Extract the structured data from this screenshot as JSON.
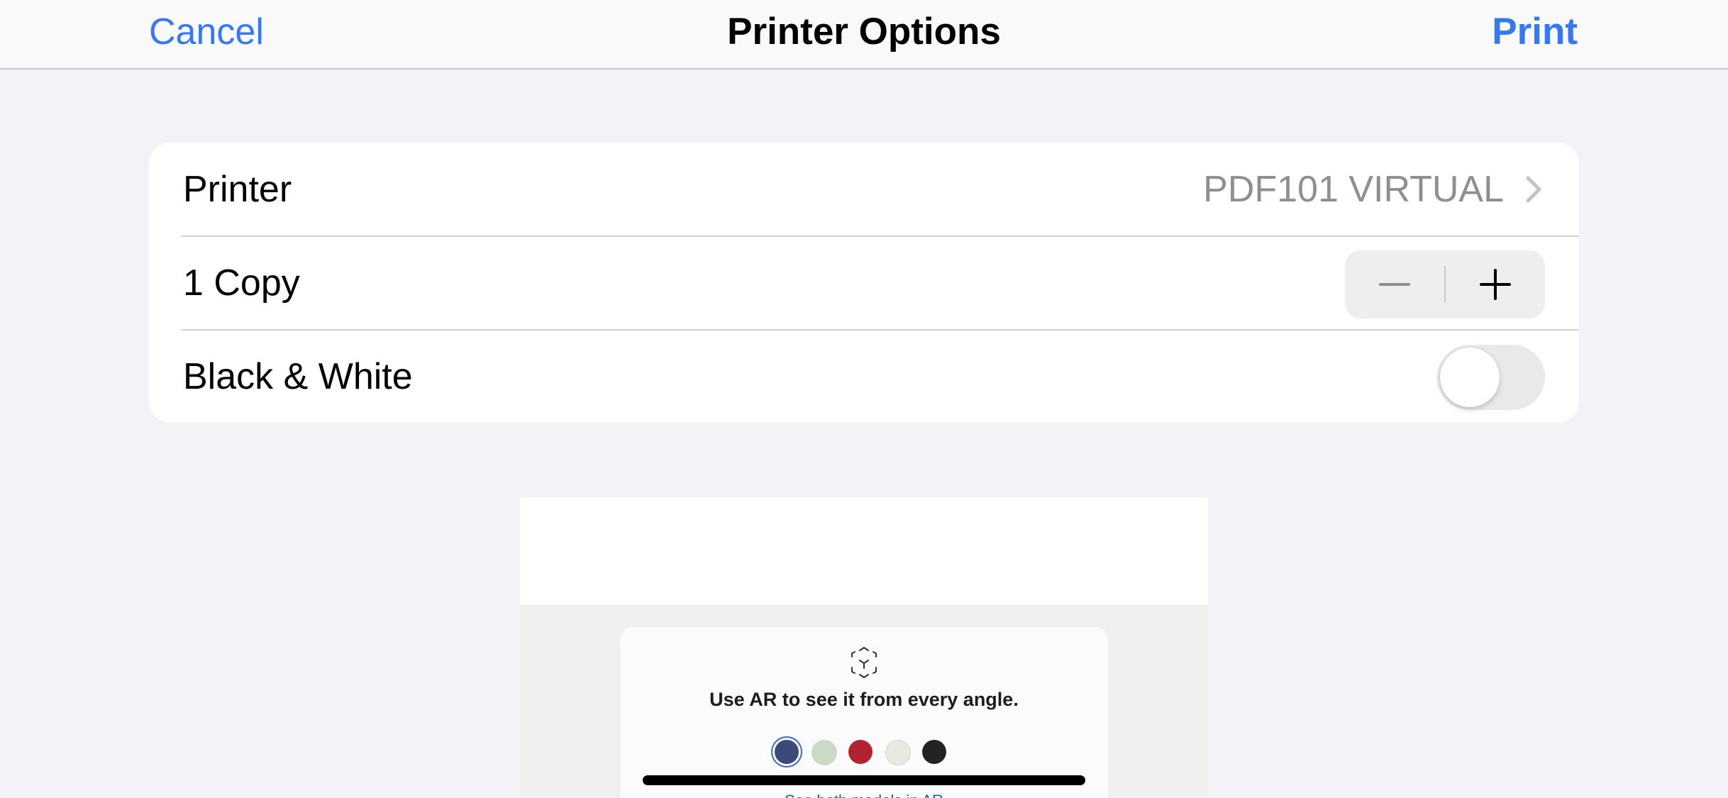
{
  "nav": {
    "cancel_label": "Cancel",
    "title": "Printer Options",
    "print_label": "Print"
  },
  "options": {
    "printer": {
      "label": "Printer",
      "value": "PDF101 VIRTUAL"
    },
    "copies": {
      "label": "1 Copy",
      "count": 1
    },
    "black_white": {
      "label": "Black & White",
      "on": false
    }
  },
  "preview": {
    "ar_prompt": "Use AR to see it from every angle.",
    "ar_link": "See both models in AR",
    "swatch_colors": [
      "#3b4a78",
      "#c9dbc5",
      "#b3232f",
      "#e8e9e0",
      "#232323"
    ],
    "selected_swatch": 0
  },
  "colors": {
    "accent": "#3478f6",
    "background": "#f2f2f7"
  }
}
